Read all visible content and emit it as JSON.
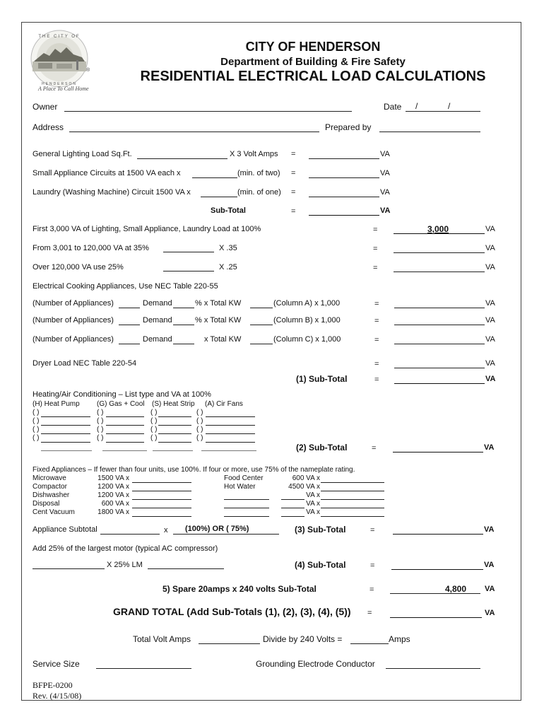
{
  "header": {
    "logo": {
      "arc_top": "THE CITY OF",
      "arc_bottom": "HENDERSON",
      "tagline": "A Place To Call Home",
      "registered": "®"
    },
    "city": "CITY OF HENDERSON",
    "department": "Department of Building & Fire Safety",
    "title": "RESIDENTIAL ELECTRICAL LOAD CALCULATIONS"
  },
  "info": {
    "owner_label": "Owner",
    "owner_value": "",
    "date_label": "Date",
    "date_sep1": "/",
    "date_sep2": "/",
    "address_label": "Address",
    "address_value": "",
    "prepared_by_label": "Prepared by",
    "prepared_by_value": ""
  },
  "general": {
    "lighting_label": "General Lighting Load Sq.Ft.",
    "lighting_mult": "X 3 Volt Amps",
    "small_appliance_label": "Small Appliance Circuits at 1500 VA each x",
    "small_appliance_min": "(min. of two)",
    "laundry_label": "Laundry (Washing Machine) Circuit 1500 VA x",
    "laundry_min": "(min. of one)",
    "subtotal_label": "Sub-Total",
    "equals": "=",
    "unit": "VA"
  },
  "demand": {
    "first_label": "First 3,000 VA of Lighting, Small Appliance, Laundry Load at 100%",
    "first_value": "3,000",
    "second_label": "From 3,001 to 120,000 VA at 35%",
    "second_mult": "X .35",
    "third_label": "Over 120,000 VA use 25%",
    "third_mult": "X .25"
  },
  "cooking": {
    "heading": "Electrical Cooking Appliances, Use NEC Table 220-55",
    "rows": [
      {
        "num": "(Number of Appliances)",
        "demand": "Demand",
        "pct": "% x Total KW",
        "col": "(Column A) x 1,000"
      },
      {
        "num": "(Number of Appliances)",
        "demand": "Demand",
        "pct": "% x Total KW",
        "col": "(Column B) x 1,000"
      },
      {
        "num": "(Number of Appliances)",
        "demand": "Demand",
        "pct": "x Total KW",
        "col": "(Column C) x 1,000"
      }
    ],
    "dryer_label": "Dryer Load NEC Table 220-54",
    "subtotal1_label": "(1) Sub-Total"
  },
  "hvac": {
    "heading": "Heating/Air Conditioning – List type and VA at 100%",
    "columns": [
      "(H) Heat Pump",
      "(G) Gas + Cool",
      "(S) Heat Strip",
      "(A) Cir Fans"
    ],
    "paren": "(  )",
    "subtotal2_label": "(2) Sub-Total"
  },
  "fixed": {
    "heading": "Fixed Appliances – If fewer than four units, use 100%.  If four or more, use 75% of the nameplate rating.",
    "left": [
      {
        "name": "Microwave",
        "va": "1500 VA x"
      },
      {
        "name": "Compactor",
        "va": "1200 VA x"
      },
      {
        "name": "Dishwasher",
        "va": "1200 VA x"
      },
      {
        "name": "Disposal",
        "va": "600 VA x"
      },
      {
        "name": "Cent Vacuum",
        "va": "1800 VA x"
      }
    ],
    "right": [
      {
        "name": "Food Center",
        "va": "600 VA x"
      },
      {
        "name": "Hot Water",
        "va": "4500 VA x"
      },
      {
        "name": "",
        "va": "VA x"
      },
      {
        "name": "",
        "va": "VA x"
      },
      {
        "name": "",
        "va": "VA x"
      }
    ],
    "appliance_subtotal_label": "Appliance Subtotal",
    "x": "x",
    "factor": "(100%) OR (  75%)",
    "subtotal3_label": "(3) Sub-Total"
  },
  "motor": {
    "heading": "Add 25% of the largest motor (typical AC compressor)",
    "mult": "X 25% LM",
    "subtotal4_label": "(4) Sub-Total"
  },
  "spare": {
    "label": "5) Spare 20amps x 240 volts Sub-Total",
    "value": "4,800"
  },
  "grand": {
    "label": "GRAND TOTAL (Add Sub-Totals (1), (2), (3), (4), (5))"
  },
  "totals": {
    "total_va_label": "Total Volt Amps",
    "divide_label": "Divide by 240 Volts =",
    "amps_label": "Amps",
    "service_label": "Service Size",
    "grounding_label": "Grounding Electrode Conductor"
  },
  "footer": {
    "form_id": "BFPE-0200",
    "revision": "Rev. (4/15/08)"
  }
}
